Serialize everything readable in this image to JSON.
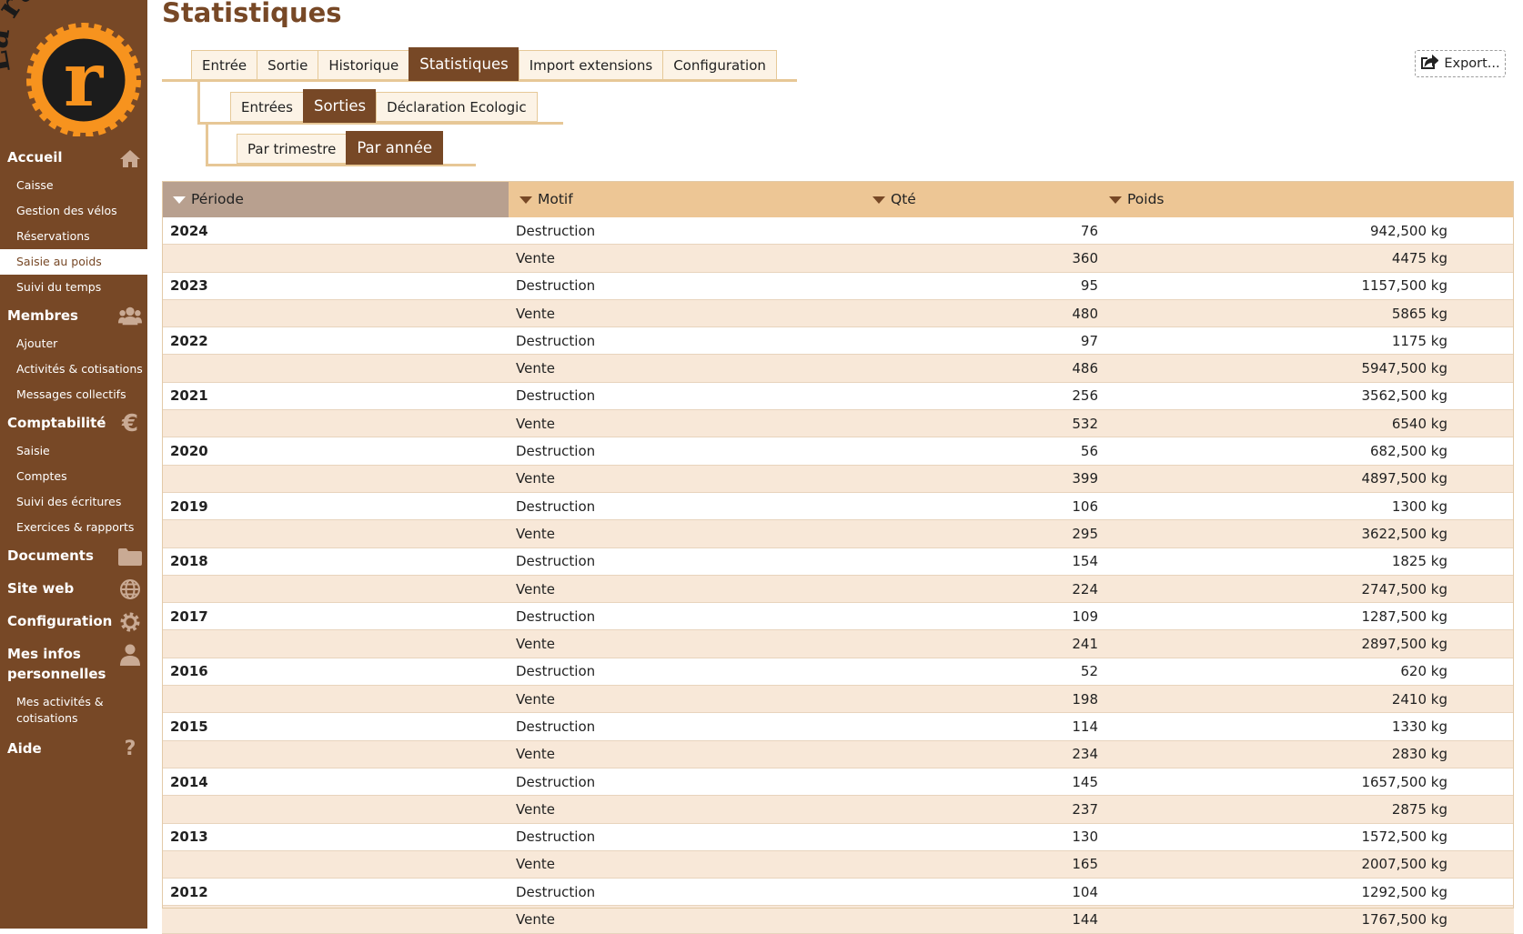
{
  "sidebar": {
    "logo_text": "La rustine",
    "logo_letter": "r",
    "sections": [
      {
        "label": "Accueil",
        "icon": "home-icon",
        "items": [
          "Caisse",
          "Gestion des vélos",
          "Réservations",
          "Saisie au poids",
          "Suivi du temps"
        ]
      },
      {
        "label": "Membres",
        "icon": "users-icon",
        "items": [
          "Ajouter",
          "Activités & cotisations",
          "Messages collectifs"
        ]
      },
      {
        "label": "Comptabilité",
        "icon": "euro-icon",
        "items": [
          "Saisie",
          "Comptes",
          "Suivi des écritures",
          "Exercices & rapports"
        ]
      },
      {
        "label": "Documents",
        "icon": "folder-icon",
        "items": []
      },
      {
        "label": "Site web",
        "icon": "globe-icon",
        "items": []
      },
      {
        "label": "Configuration",
        "icon": "gear-icon",
        "items": []
      },
      {
        "label": "Mes infos personnelles",
        "icon": "user-icon",
        "items": [
          "Mes activités & cotisations"
        ]
      },
      {
        "label": "Aide",
        "icon": "help-icon",
        "items": []
      }
    ],
    "active_item": "Saisie au poids"
  },
  "page": {
    "title": "Statistiques"
  },
  "tabs_main": {
    "items": [
      "Entrée",
      "Sortie",
      "Historique",
      "Statistiques",
      "Import extensions",
      "Configuration"
    ],
    "active": "Statistiques"
  },
  "tabs_sub": {
    "items": [
      "Entrées",
      "Sorties",
      "Déclaration Ecologic"
    ],
    "active": "Sorties"
  },
  "tabs_period": {
    "items": [
      "Par trimestre",
      "Par année"
    ],
    "active": "Par année"
  },
  "toolbar": {
    "export_label": "Export..."
  },
  "table": {
    "columns": {
      "periode": "Période",
      "motif": "Motif",
      "qte": "Qté",
      "poids": "Poids"
    },
    "sorted_column": "Période",
    "rows": [
      {
        "periode": "2024",
        "motif": "Destruction",
        "qte": "76",
        "poids": "942,500 kg"
      },
      {
        "periode": "",
        "motif": "Vente",
        "qte": "360",
        "poids": "4475 kg"
      },
      {
        "periode": "2023",
        "motif": "Destruction",
        "qte": "95",
        "poids": "1157,500 kg"
      },
      {
        "periode": "",
        "motif": "Vente",
        "qte": "480",
        "poids": "5865 kg"
      },
      {
        "periode": "2022",
        "motif": "Destruction",
        "qte": "97",
        "poids": "1175 kg"
      },
      {
        "periode": "",
        "motif": "Vente",
        "qte": "486",
        "poids": "5947,500 kg"
      },
      {
        "periode": "2021",
        "motif": "Destruction",
        "qte": "256",
        "poids": "3562,500 kg"
      },
      {
        "periode": "",
        "motif": "Vente",
        "qte": "532",
        "poids": "6540 kg"
      },
      {
        "periode": "2020",
        "motif": "Destruction",
        "qte": "56",
        "poids": "682,500 kg"
      },
      {
        "periode": "",
        "motif": "Vente",
        "qte": "399",
        "poids": "4897,500 kg"
      },
      {
        "periode": "2019",
        "motif": "Destruction",
        "qte": "106",
        "poids": "1300 kg"
      },
      {
        "periode": "",
        "motif": "Vente",
        "qte": "295",
        "poids": "3622,500 kg"
      },
      {
        "periode": "2018",
        "motif": "Destruction",
        "qte": "154",
        "poids": "1825 kg"
      },
      {
        "periode": "",
        "motif": "Vente",
        "qte": "224",
        "poids": "2747,500 kg"
      },
      {
        "periode": "2017",
        "motif": "Destruction",
        "qte": "109",
        "poids": "1287,500 kg"
      },
      {
        "periode": "",
        "motif": "Vente",
        "qte": "241",
        "poids": "2897,500 kg"
      },
      {
        "periode": "2016",
        "motif": "Destruction",
        "qte": "52",
        "poids": "620 kg"
      },
      {
        "periode": "",
        "motif": "Vente",
        "qte": "198",
        "poids": "2410 kg"
      },
      {
        "periode": "2015",
        "motif": "Destruction",
        "qte": "114",
        "poids": "1330 kg"
      },
      {
        "periode": "",
        "motif": "Vente",
        "qte": "234",
        "poids": "2830 kg"
      },
      {
        "periode": "2014",
        "motif": "Destruction",
        "qte": "145",
        "poids": "1657,500 kg"
      },
      {
        "periode": "",
        "motif": "Vente",
        "qte": "237",
        "poids": "2875 kg"
      },
      {
        "periode": "2013",
        "motif": "Destruction",
        "qte": "130",
        "poids": "1572,500 kg"
      },
      {
        "periode": "",
        "motif": "Vente",
        "qte": "165",
        "poids": "2007,500 kg"
      },
      {
        "periode": "2012",
        "motif": "Destruction",
        "qte": "104",
        "poids": "1292,500 kg"
      },
      {
        "periode": "",
        "motif": "Vente",
        "qte": "144",
        "poids": "1767,500 kg"
      }
    ]
  },
  "colors": {
    "brand": "#774826",
    "accent": "#f7931e",
    "header": "#edc695",
    "row_alt": "#f8e8d8"
  }
}
